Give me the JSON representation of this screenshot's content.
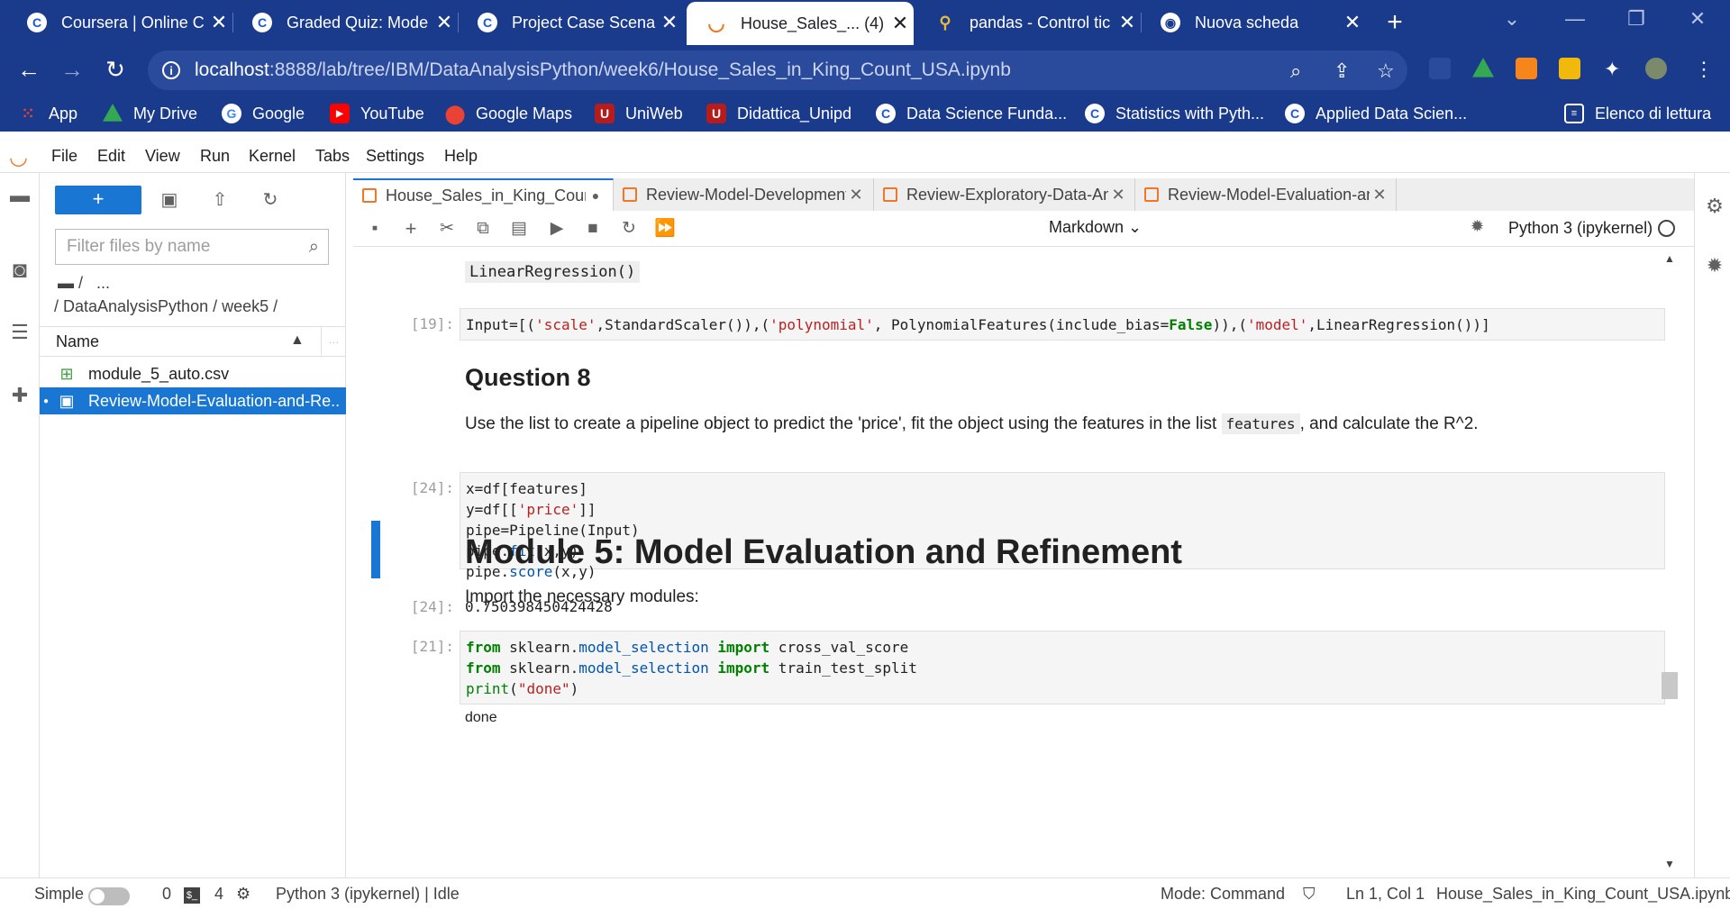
{
  "browser": {
    "tabs": [
      {
        "title": "Coursera | Online C",
        "icon": "coursera-icon"
      },
      {
        "title": "Graded Quiz: Mode",
        "icon": "coursera-icon"
      },
      {
        "title": "Project Case Scenar",
        "icon": "coursera-icon"
      },
      {
        "title": "House_Sales_... (4)",
        "icon": "jupyter-icon"
      },
      {
        "title": "pandas - Control tic",
        "icon": "pandas-icon"
      },
      {
        "title": "Nuova scheda",
        "icon": "chrome-icon"
      }
    ],
    "url_host": "localhost",
    "url_path": ":8888/lab/tree/IBM/DataAnalysisPython/week6/House_Sales_in_King_Count_USA.ipynb",
    "bookmarks": [
      {
        "label": "App",
        "icon": "apps-grid-icon"
      },
      {
        "label": "My Drive",
        "icon": "drive-icon"
      },
      {
        "label": "Google",
        "icon": "google-icon"
      },
      {
        "label": "YouTube",
        "icon": "youtube-icon"
      },
      {
        "label": "Google Maps",
        "icon": "maps-icon"
      },
      {
        "label": "UniWeb",
        "icon": "unipd-icon"
      },
      {
        "label": "Didattica_Unipd",
        "icon": "unipd-icon"
      },
      {
        "label": "Data Science Funda...",
        "icon": "coursera-icon"
      },
      {
        "label": "Statistics with Pyth...",
        "icon": "coursera-icon"
      },
      {
        "label": "Applied Data Scien...",
        "icon": "coursera-icon"
      }
    ],
    "reading_list": "Elenco di lettura"
  },
  "jupyter": {
    "menu": [
      "File",
      "Edit",
      "View",
      "Run",
      "Kernel",
      "Tabs",
      "Settings",
      "Help"
    ],
    "filebrowser": {
      "filter_placeholder": "Filter files by name",
      "crumb_root": "/",
      "crumb_more": "...",
      "crumb_path": "/ DataAnalysisPython / week5 /",
      "column_name": "Name",
      "files": [
        {
          "name": "module_5_auto.csv",
          "type": "csv",
          "selected": false
        },
        {
          "name": "Review-Model-Evaluation-and-Re...",
          "type": "notebook",
          "selected": true
        }
      ]
    },
    "notebook_tabs": [
      {
        "title": "House_Sales_in_King_Count_",
        "active": true,
        "dirty": true
      },
      {
        "title": "Review-Model-Development",
        "active": false
      },
      {
        "title": "Review-Exploratory-Data-An",
        "active": false
      },
      {
        "title": "Review-Model-Evaluation-an",
        "active": false
      }
    ],
    "toolbar": {
      "cell_type": "Markdown",
      "kernel": "Python 3 (ipykernel)"
    },
    "cells": {
      "prev_output": "LinearRegression()",
      "c19_prompt": "[19]:",
      "q8_heading": "Question 8",
      "q8_text_before": "Use the list to create a pipeline object to predict the 'price', fit the object using the features in the list",
      "q8_inline": "features",
      "q8_text_after": ", and calculate the R^2.",
      "c24_prompt": "[24]:",
      "c24_out_prompt": "[24]:",
      "c24_output": "0.750398450424428",
      "mod5_heading": "Module 5: Model Evaluation and Refinement",
      "mod5_text": "Import the necessary modules:",
      "c21_prompt": "[21]:",
      "c21_output": "done"
    },
    "status": {
      "mode_label": "Simple",
      "terminals": "0",
      "kernels": "4",
      "kernel_status": "Python 3 (ipykernel) | Idle",
      "mode": "Mode: Command",
      "position": "Ln 1, Col 1",
      "filename": "House_Sales_in_King_Count_USA.ipynb"
    }
  }
}
